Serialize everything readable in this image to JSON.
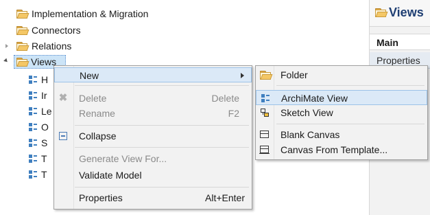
{
  "tree": {
    "items": [
      {
        "label": "Implementation & Migration"
      },
      {
        "label": "Connectors"
      },
      {
        "label": "Relations"
      },
      {
        "label": "Views"
      }
    ],
    "view_children": [
      {
        "label": "H"
      },
      {
        "label": "Ir"
      },
      {
        "label": "Le"
      },
      {
        "label": "O"
      },
      {
        "label": "S"
      },
      {
        "label": "T"
      },
      {
        "label": "T"
      }
    ]
  },
  "right_panel": {
    "title": "Views",
    "tab_main": "Main",
    "tab_properties": "Properties"
  },
  "context_menu": {
    "new": "New",
    "delete": "Delete",
    "delete_shortcut": "Delete",
    "rename": "Rename",
    "rename_shortcut": "F2",
    "collapse": "Collapse",
    "generate_view": "Generate View For...",
    "validate_model": "Validate Model",
    "properties": "Properties",
    "properties_shortcut": "Alt+Enter"
  },
  "submenu": {
    "folder": "Folder",
    "archimate_view": "ArchiMate View",
    "sketch_view": "Sketch View",
    "blank_canvas": "Blank Canvas",
    "canvas_from_template": "Canvas From Template..."
  },
  "colors": {
    "selection": "#cce4f7",
    "hover": "#dbe9f7",
    "panel_title": "#1f3f73"
  }
}
